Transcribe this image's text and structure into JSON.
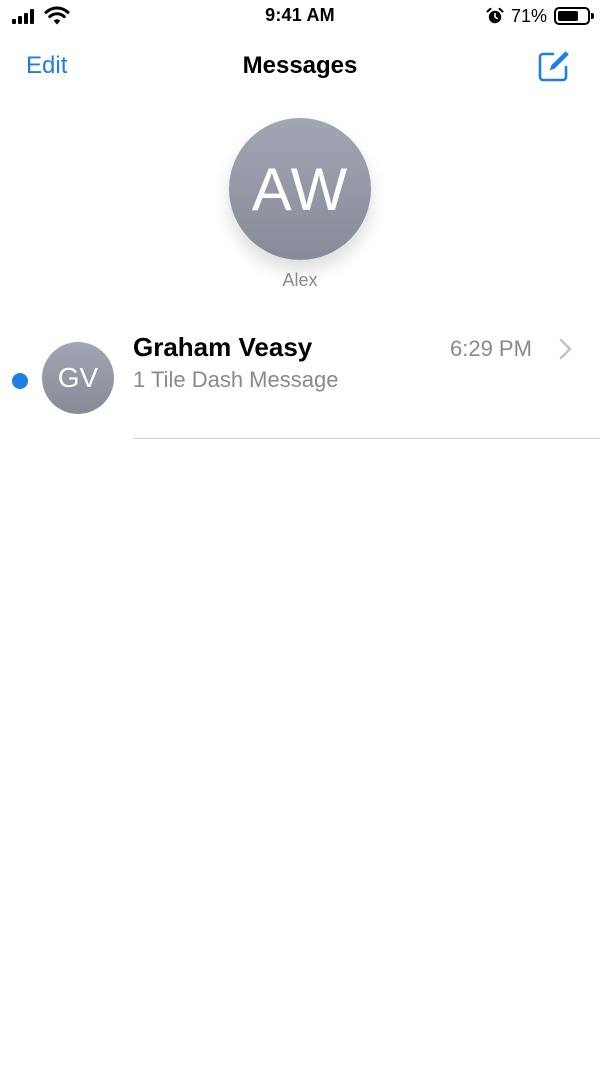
{
  "status_bar": {
    "time": "9:41 AM",
    "battery_percent": "71%",
    "battery_level": 0.71,
    "icons": [
      "cellular-signal-icon",
      "wifi-icon",
      "alarm-icon",
      "battery-icon"
    ]
  },
  "nav": {
    "edit_label": "Edit",
    "title": "Messages",
    "compose_icon": "compose-icon"
  },
  "pinned": {
    "initials": "AW",
    "name": "Alex"
  },
  "conversations": [
    {
      "initials": "GV",
      "name": "Graham Veasy",
      "time": "6:29 PM",
      "preview": "1 Tile Dash Message",
      "unread": true
    }
  ],
  "colors": {
    "accent": "#1e7ee3",
    "secondary_text": "#8a8a8e",
    "avatar_gray": "#8f939f"
  }
}
